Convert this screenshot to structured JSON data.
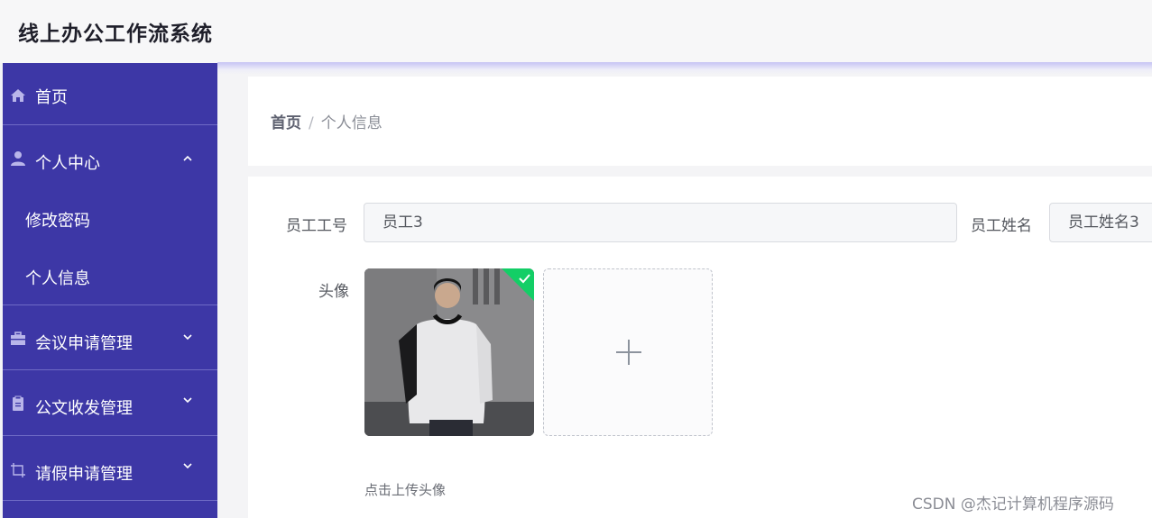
{
  "app": {
    "title": "线上办公工作流系统"
  },
  "sidebar": {
    "items": [
      {
        "label": "首页",
        "icon": "home-icon"
      },
      {
        "label": "个人中心",
        "icon": "user-icon",
        "expanded": true,
        "children": [
          "修改密码",
          "个人信息"
        ]
      },
      {
        "label": "会议申请管理",
        "icon": "briefcase-icon"
      },
      {
        "label": "公文收发管理",
        "icon": "clipboard-icon"
      },
      {
        "label": "请假申请管理",
        "icon": "crop-icon"
      }
    ]
  },
  "breadcrumb": {
    "home": "首页",
    "separator": "/",
    "current": "个人信息"
  },
  "form": {
    "employee_no": {
      "label": "员工工号",
      "value": "员工3"
    },
    "employee_name": {
      "label": "员工姓名",
      "value": "员工姓名3"
    },
    "avatar": {
      "label": "头像",
      "upload_icon": "plus-icon",
      "tip": "点击上传头像"
    }
  },
  "colors": {
    "sidebar": "#3d37a6",
    "success": "#13ce66"
  },
  "watermark": "CSDN @杰记计算机程序源码"
}
